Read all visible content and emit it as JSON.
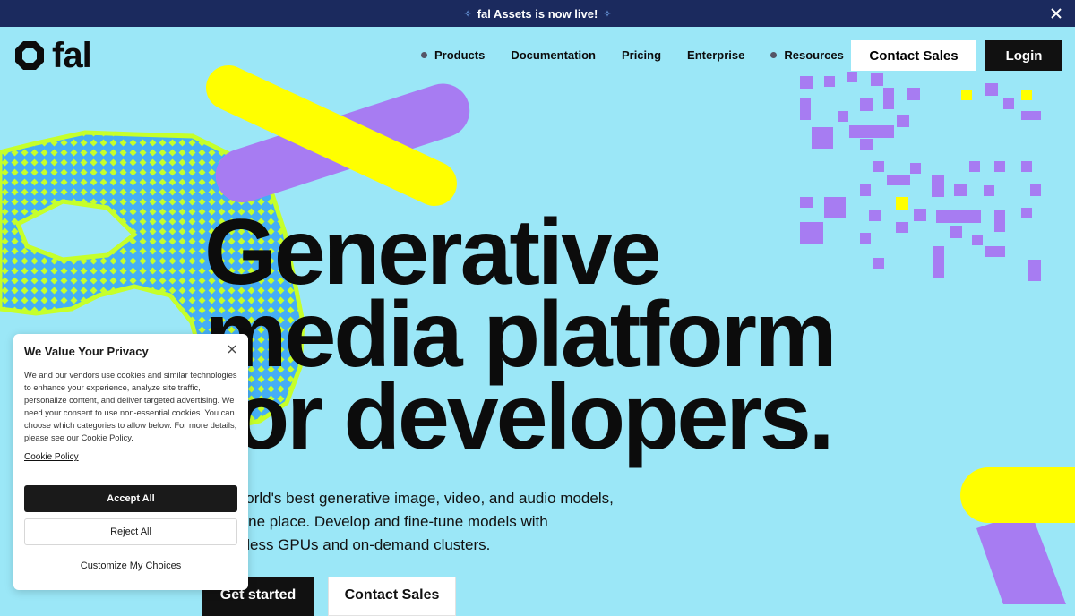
{
  "banner": {
    "text": "fal Assets is now live!",
    "close_icon": "close-icon",
    "sparkle_icon": "sparkle-icon"
  },
  "brand": {
    "logo_text": "fal",
    "logo_icon": "fal-logo-icon"
  },
  "nav": {
    "items": [
      {
        "label": "Products",
        "has_dot": true
      },
      {
        "label": "Documentation",
        "has_dot": false
      },
      {
        "label": "Pricing",
        "has_dot": false
      },
      {
        "label": "Enterprise",
        "has_dot": false
      },
      {
        "label": "Resources",
        "has_dot": true
      }
    ],
    "contact_sales": "Contact Sales",
    "login": "Login"
  },
  "hero": {
    "title_lines": [
      "Generative",
      "media platform",
      "for developers."
    ],
    "subtitle_lines": [
      "The world's best generative image, video, and audio models,",
      "all in one place. Develop and fine-tune models with",
      "serverless GPUs and on-demand clusters."
    ],
    "cta_primary": "Get started",
    "cta_secondary": "Contact Sales"
  },
  "cookie_banner": {
    "title": "We Value Your Privacy",
    "body": "We and our vendors use cookies and similar technologies to enhance your experience, analyze site traffic, personalize content, and deliver targeted advertising. We need your consent to use non-essential cookies. You can choose which categories to allow below. For more details, please see our Cookie Policy.",
    "policy_link": "Cookie Policy",
    "accept_all": "Accept All",
    "reject_all": "Reject All",
    "customize": "Customize My Choices"
  },
  "colors": {
    "background": "#9be7f7",
    "banner": "#1b2a5e",
    "yellow": "#ffff00",
    "purple": "#a77cf2",
    "blue_blob": "#45aef5",
    "lime": "#c6ff2a",
    "black": "#0c0c0c"
  }
}
